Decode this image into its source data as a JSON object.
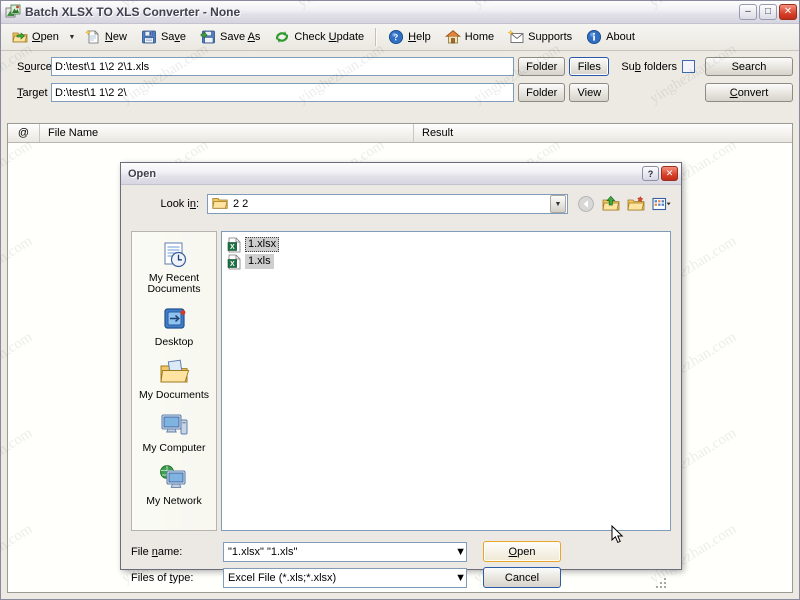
{
  "app": {
    "title": "Batch XLSX TO XLS Converter - None",
    "window_buttons": {
      "minimize": "–",
      "maximize": "□",
      "close": "✕"
    },
    "toolbar": [
      {
        "label": "Open",
        "accel": "O",
        "icon": "open-folder-icon",
        "has_dropdown": true
      },
      {
        "label": "New",
        "accel": "N",
        "icon": "new-document-icon",
        "has_dropdown": false
      },
      {
        "label": "Save",
        "accel": "v",
        "icon": "save-floppy-icon",
        "has_dropdown": false
      },
      {
        "label": "Save As",
        "accel": "A",
        "icon": "save-as-icon",
        "has_dropdown": false
      },
      {
        "label": "Check Update",
        "accel": "U",
        "icon": "refresh-icon",
        "has_dropdown": false
      },
      {
        "label": "Help",
        "accel": "H",
        "icon": "help-circle-icon",
        "has_dropdown": false
      },
      {
        "label": "Home",
        "accel": "",
        "icon": "home-icon",
        "has_dropdown": false
      },
      {
        "label": "Supports",
        "accel": "",
        "icon": "supports-icon",
        "has_dropdown": false
      },
      {
        "label": "About",
        "accel": "",
        "icon": "info-icon",
        "has_dropdown": false
      }
    ],
    "source": {
      "label": "Source",
      "accel": "o",
      "value": "D:\\test\\1 1\\2 2\\1.xls",
      "folder_button": "Folder",
      "files_button": "Files",
      "subfolders_label": "Sub folders",
      "subfolders_accel": "b",
      "subfolders_checked": false,
      "search_button": "Search"
    },
    "target": {
      "label": "Target",
      "accel": "T",
      "value": "D:\\test\\1 1\\2 2\\",
      "folder_button": "Folder",
      "view_button": "View",
      "convert_button": "Convert",
      "convert_accel": "C"
    },
    "list": {
      "columns": [
        "@",
        "File Name",
        "Result"
      ],
      "rows": []
    }
  },
  "dialog": {
    "title": "Open",
    "help_button": "?",
    "close_button": "✕",
    "look_in": {
      "label": "Look in:",
      "accel": "n",
      "value": "2 2",
      "icon": "folder-icon"
    },
    "nav_tools": [
      {
        "name": "back-icon",
        "tip": "Back"
      },
      {
        "name": "up-level-icon",
        "tip": "Up One Level"
      },
      {
        "name": "new-folder-icon",
        "tip": "Create New Folder"
      },
      {
        "name": "views-icon",
        "tip": "Views"
      }
    ],
    "places": [
      {
        "label": "My Recent Documents",
        "icon": "recent-documents-icon"
      },
      {
        "label": "Desktop",
        "icon": "desktop-icon"
      },
      {
        "label": "My Documents",
        "icon": "my-documents-icon"
      },
      {
        "label": "My Computer",
        "icon": "my-computer-icon"
      },
      {
        "label": "My Network",
        "icon": "my-network-icon"
      }
    ],
    "files": [
      {
        "name": "1.xlsx",
        "icon": "excel-file-icon",
        "selected": true,
        "focused": true
      },
      {
        "name": "1.xls",
        "icon": "excel-file-icon",
        "selected": true,
        "focused": false
      }
    ],
    "file_name": {
      "label": "File name:",
      "accel": "n",
      "value": "\"1.xlsx\" \"1.xls\""
    },
    "files_of_type": {
      "label": "Files of type:",
      "accel": "t",
      "value": "Excel File (*.xls;*.xlsx)"
    },
    "open_button": "Open",
    "open_accel": "O",
    "cancel_button": "Cancel"
  },
  "watermark": {
    "text": "yinghezhan.com"
  },
  "colors": {
    "window_bg": "#eceae3",
    "dialog_bg": "#ece9e4",
    "field_border": "#7f9db9",
    "default_button_border": "#2c5ba8",
    "hot_button_border": "#e9a42a",
    "selection": "#cfcfcf",
    "excel_green": "#1e7145",
    "close_red": "#d8402a"
  }
}
